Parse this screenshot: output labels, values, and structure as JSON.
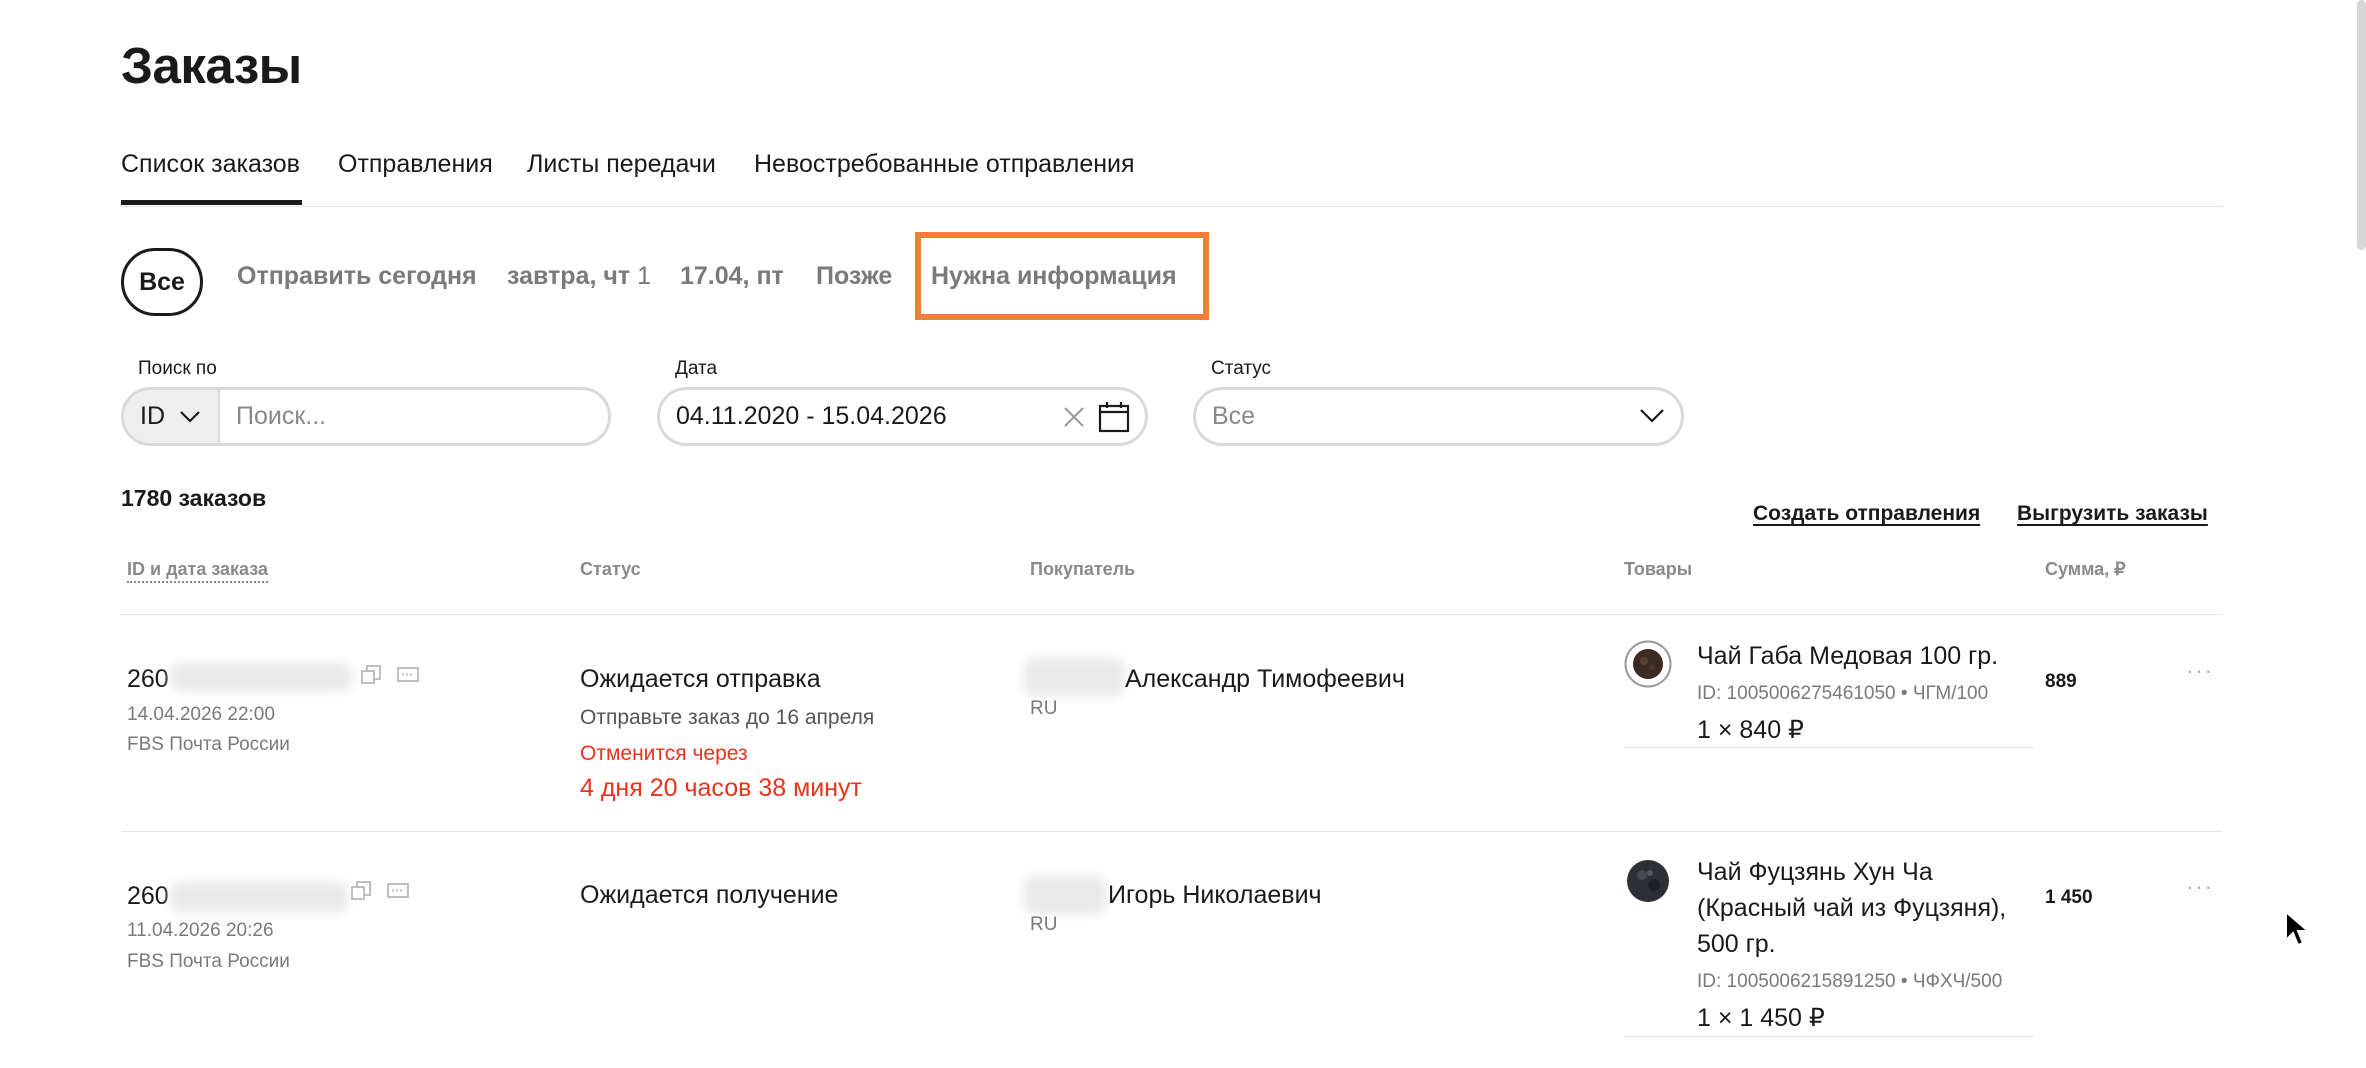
{
  "page": {
    "title": "Заказы"
  },
  "tabs": [
    {
      "label": "Список заказов",
      "active": true
    },
    {
      "label": "Отправления"
    },
    {
      "label": "Листы передачи"
    },
    {
      "label": "Невостребованные отправления"
    }
  ],
  "filters_chips": {
    "all": "Все",
    "today": "Отправить сегодня",
    "tomorrow": "завтра, чт",
    "tomorrow_count": "1",
    "date": "17.04, пт",
    "later": "Позже",
    "need_info": "Нужна информация"
  },
  "search": {
    "label": "Поиск по",
    "type_value": "ID",
    "placeholder": "Поиск..."
  },
  "date_filter": {
    "label": "Дата",
    "value": "04.11.2020 - 15.04.2026"
  },
  "status_filter": {
    "label": "Статус",
    "value": "Все"
  },
  "summary": {
    "count": "1780 заказов"
  },
  "actions": {
    "create": "Создать отправления",
    "export": "Выгрузить заказы"
  },
  "columns": {
    "id_date": "ID и дата заказа",
    "status": "Статус",
    "buyer": "Покупатель",
    "goods": "Товары",
    "sum": "Сумма, ₽"
  },
  "orders": [
    {
      "id_prefix": "260",
      "date": "14.04.2026 22:00",
      "delivery": "FBS Почта России",
      "status": "Ожидается отправка",
      "status_note": "Отправьте заказ до 16 апреля",
      "cancel_label": "Отменится через",
      "cancel_time": "4 дня 20 часов 38 минут",
      "buyer_name": "Александр Тимофеевич",
      "buyer_country": "RU",
      "product_name": "Чай Габа Медовая 100 гр.",
      "product_id": "ID: 1005006275461050 • ЧГМ/100",
      "product_qty": "1 × 840 ₽",
      "sum": "889"
    },
    {
      "id_prefix": "260",
      "date": "11.04.2026 20:26",
      "delivery": "FBS Почта России",
      "status": "Ожидается получение",
      "buyer_name": "Игорь Николаевич",
      "buyer_country": "RU",
      "product_name_lines": [
        "Чай Фуцзянь Хун Ча",
        "(Красный чай из Фуцзяня),",
        "500 гр."
      ],
      "product_id": "ID: 1005006215891250 • ЧФХЧ/500",
      "product_qty": "1 × 1 450 ₽",
      "sum": "1 450"
    }
  ],
  "colors": {
    "accent_highlight": "#f37e3a",
    "danger": "#e8341c"
  }
}
